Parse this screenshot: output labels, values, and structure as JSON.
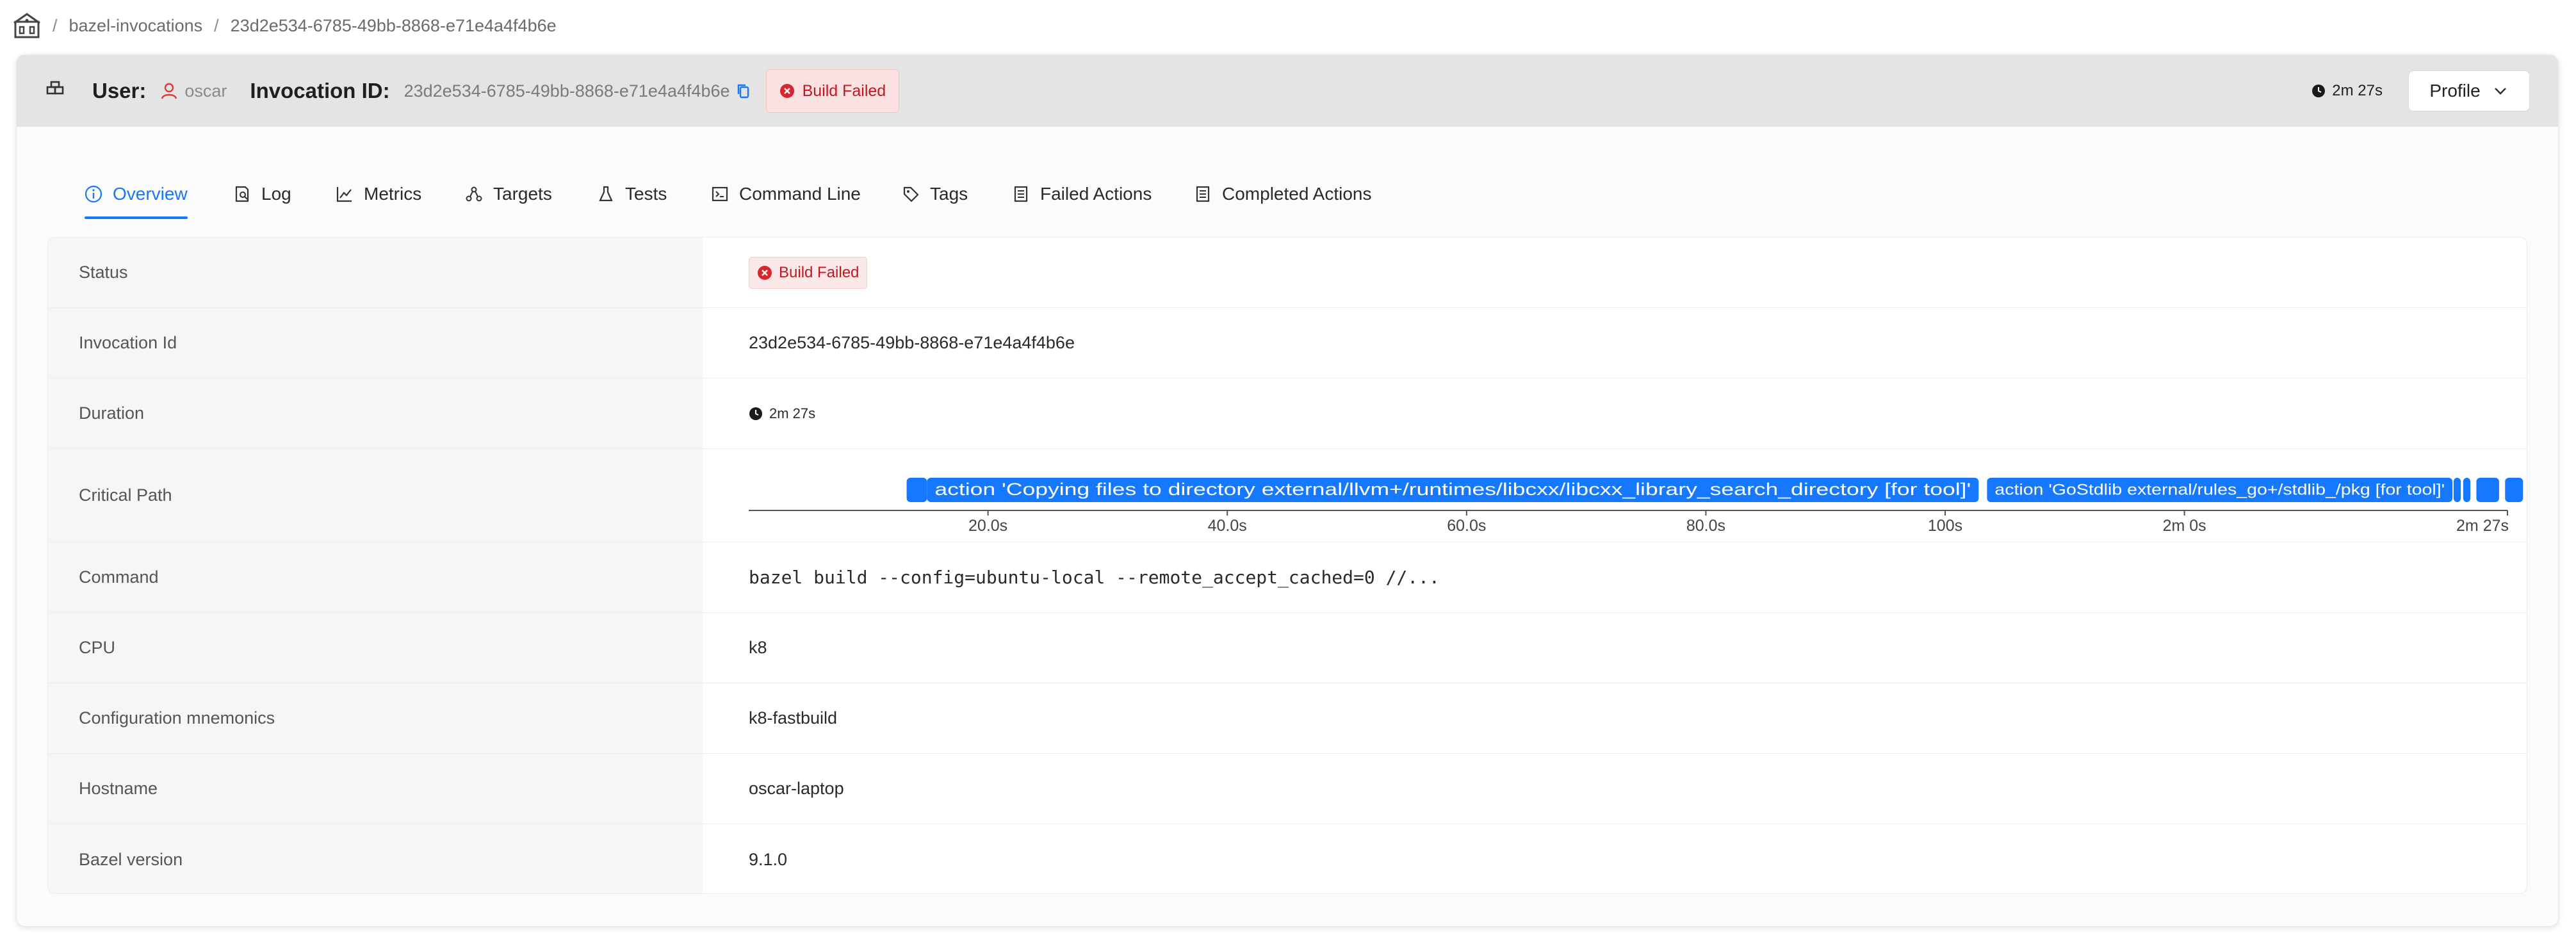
{
  "breadcrumb": {
    "home_icon": "home-icon",
    "items": [
      "bazel-invocations",
      "23d2e534-6785-49bb-8868-e71e4a4f4b6e"
    ],
    "separator": "/"
  },
  "header": {
    "cube_icon": "cube-icon",
    "user_label": "User:",
    "user_name": "oscar",
    "invocation_label": "Invocation ID:",
    "invocation_id": "23d2e534-6785-49bb-8868-e71e4a4f4b6e",
    "status": "Build Failed",
    "duration": "2m 27s",
    "profile_label": "Profile"
  },
  "tabs": [
    {
      "label": "Overview",
      "icon": "info-icon",
      "active": true
    },
    {
      "label": "Log",
      "icon": "log-icon"
    },
    {
      "label": "Metrics",
      "icon": "chart-icon"
    },
    {
      "label": "Targets",
      "icon": "targets-icon"
    },
    {
      "label": "Tests",
      "icon": "flask-icon"
    },
    {
      "label": "Command Line",
      "icon": "terminal-icon"
    },
    {
      "label": "Tags",
      "icon": "tag-icon"
    },
    {
      "label": "Failed Actions",
      "icon": "list-icon"
    },
    {
      "label": "Completed Actions",
      "icon": "list-icon"
    }
  ],
  "info": {
    "status_label": "Status",
    "status_value": "Build Failed",
    "invocation_label": "Invocation Id",
    "invocation_value": "23d2e534-6785-49bb-8868-e71e4a4f4b6e",
    "duration_label": "Duration",
    "duration_value": "2m 27s",
    "critical_path_label": "Critical Path",
    "command_label": "Command",
    "command_value": "bazel build --config=ubuntu-local --remote_accept_cached=0 //...",
    "cpu_label": "CPU",
    "cpu_value": "k8",
    "config_label": "Configuration mnemonics",
    "config_value": "k8-fastbuild",
    "hostname_label": "Hostname",
    "hostname_value": "oscar-laptop",
    "bazel_label": "Bazel version",
    "bazel_value": "9.1.0"
  },
  "chart_data": {
    "type": "timeline",
    "xlim": [
      0,
      147
    ],
    "x_ticks": [
      {
        "value": 20,
        "label": "20.0s"
      },
      {
        "value": 40,
        "label": "40.0s"
      },
      {
        "value": 60,
        "label": "60.0s"
      },
      {
        "value": 80,
        "label": "80.0s"
      },
      {
        "value": 100,
        "label": "100s"
      },
      {
        "value": 120,
        "label": "2m 0s"
      },
      {
        "value": 147,
        "label": "2m 27s"
      }
    ],
    "segments": [
      {
        "start": 13.2,
        "end": 14.9,
        "label": ""
      },
      {
        "start": 14.9,
        "end": 102.8,
        "label": "action 'Copying files to directory external/llvm+/runtimes/libcxx/libcxx_library_search_directory [for tool]'"
      },
      {
        "start": 103.5,
        "end": 142.4,
        "label": "action 'GoStdlib external/rules_go+/stdlib_/pkg [for tool]'"
      },
      {
        "start": 142.5,
        "end": 143.1,
        "label": ""
      },
      {
        "start": 143.3,
        "end": 143.9,
        "label": ""
      },
      {
        "start": 144.4,
        "end": 146.3,
        "label": ""
      },
      {
        "start": 146.8,
        "end": 148.3,
        "label": ""
      }
    ],
    "bar_color": "#1677ff"
  }
}
